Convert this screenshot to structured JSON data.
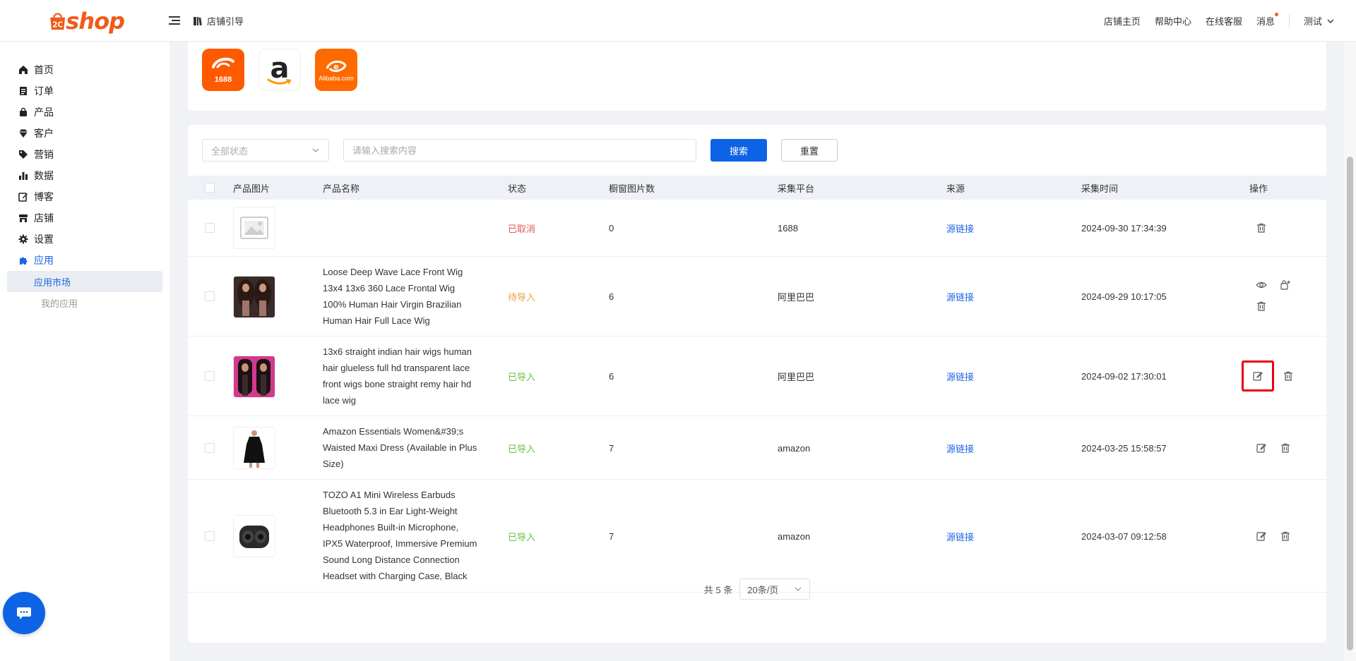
{
  "header": {
    "logo_text": "shop",
    "store_guide": "店铺引导",
    "nav": [
      "店铺主页",
      "帮助中心",
      "在线客服",
      "消息"
    ],
    "user": "测试"
  },
  "sidebar": {
    "items": [
      {
        "label": "首页",
        "icon": "home-icon"
      },
      {
        "label": "订单",
        "icon": "order-icon"
      },
      {
        "label": "产品",
        "icon": "bag-icon"
      },
      {
        "label": "客户",
        "icon": "diamond-icon"
      },
      {
        "label": "营销",
        "icon": "tag-icon"
      },
      {
        "label": "数据",
        "icon": "bar-chart-icon"
      },
      {
        "label": "博客",
        "icon": "edit-icon"
      },
      {
        "label": "店铺",
        "icon": "store-icon"
      },
      {
        "label": "设置",
        "icon": "gear-icon"
      },
      {
        "label": "应用",
        "icon": "puzzle-icon"
      }
    ],
    "sub_items": [
      "应用市场",
      "我的应用"
    ]
  },
  "platforms": {
    "p1688": {
      "label": "1688",
      "color": "#ff5a00"
    },
    "amazon": {
      "label": "a",
      "color": "#222222"
    },
    "alibaba": {
      "label": "Alibaba.com",
      "color": "#ff6a00"
    }
  },
  "filters": {
    "status_placeholder": "全部状态",
    "search_placeholder": "请输入搜索内容",
    "search_label": "搜索",
    "reset_label": "重置"
  },
  "table": {
    "headers": [
      "产品图片",
      "产品名称",
      "状态",
      "橱窗图片数",
      "采集平台",
      "来源",
      "采集时间",
      "操作"
    ],
    "rows": [
      {
        "name": "",
        "status": "已取消",
        "count": "0",
        "platform": "1688",
        "source": "源链接",
        "time": "2024-09-30 17:34:39"
      },
      {
        "name": "Loose Deep Wave Lace Front Wig 13x4 13x6 360 Lace Frontal Wig 100% Human Hair Virgin Brazilian Human Hair Full Lace Wig",
        "status": "待导入",
        "count": "6",
        "platform": "阿里巴巴",
        "source": "源链接",
        "time": "2024-09-29 10:17:05"
      },
      {
        "name": "13x6 straight indian hair wigs human hair glueless full hd transparent lace front wigs bone straight remy hair hd lace wig",
        "status": "已导入",
        "count": "6",
        "platform": "阿里巴巴",
        "source": "源链接",
        "time": "2024-09-02 17:30:01"
      },
      {
        "name": "Amazon Essentials Women&#39;s Waisted Maxi Dress (Available in Plus Size)",
        "status": "已导入",
        "count": "7",
        "platform": "amazon",
        "source": "源链接",
        "time": "2024-03-25 15:58:57"
      },
      {
        "name": "TOZO A1 Mini Wireless Earbuds Bluetooth 5.3 in Ear Light-Weight Headphones Built-in Microphone, IPX5 Waterproof, Immersive Premium Sound Long Distance Connection Headset with Charging Case, Black",
        "status": "已导入",
        "count": "7",
        "platform": "amazon",
        "source": "源链接",
        "time": "2024-03-07 09:12:58"
      }
    ]
  },
  "pagination": {
    "total": "共 5 条",
    "page_size": "20条/页"
  }
}
